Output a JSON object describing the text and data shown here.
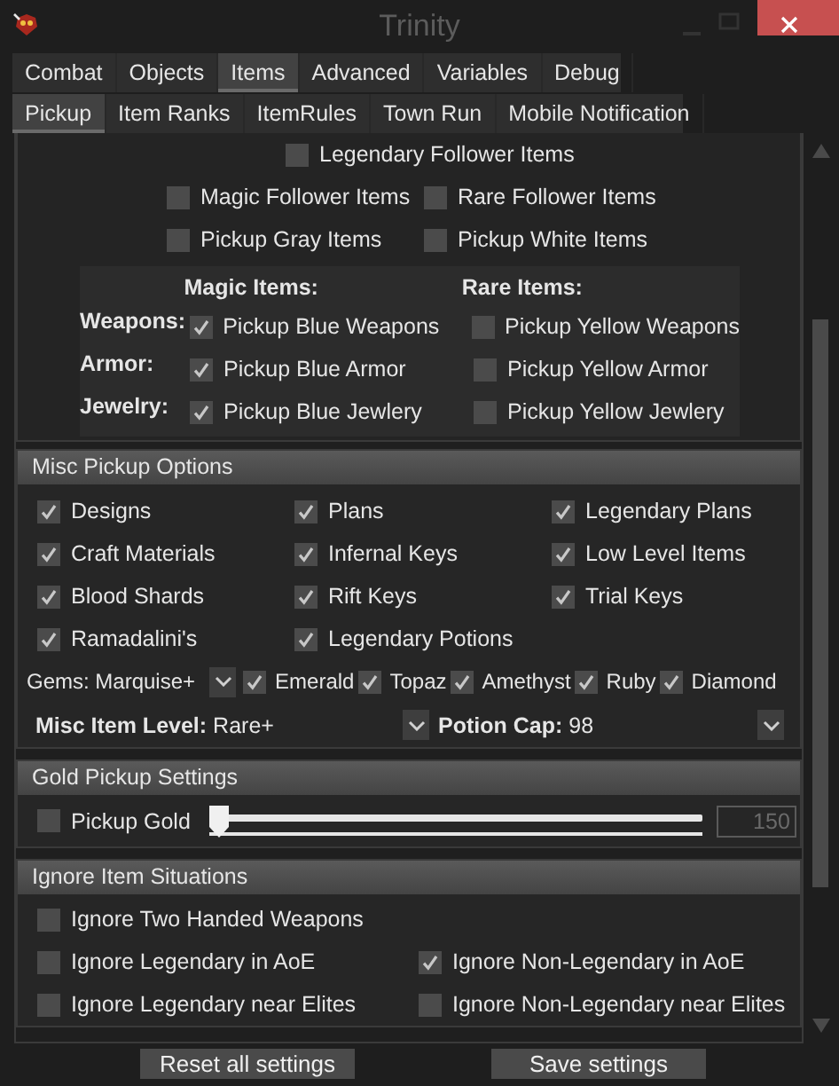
{
  "window": {
    "title": "Trinity"
  },
  "tabs": [
    {
      "label": "Combat",
      "selected": false
    },
    {
      "label": "Objects",
      "selected": false
    },
    {
      "label": "Items",
      "selected": true
    },
    {
      "label": "Advanced",
      "selected": false
    },
    {
      "label": "Variables",
      "selected": false
    },
    {
      "label": "Debug",
      "selected": false
    }
  ],
  "subtabs": [
    {
      "label": "Pickup",
      "selected": true
    },
    {
      "label": "Item Ranks",
      "selected": false
    },
    {
      "label": "ItemRules",
      "selected": false
    },
    {
      "label": "Town Run",
      "selected": false
    },
    {
      "label": "Mobile Notification",
      "selected": false
    }
  ],
  "follower": {
    "top_item": {
      "label": "Legendary Follower Items",
      "checked": false
    },
    "rows": [
      [
        {
          "label": "Magic Follower Items",
          "checked": false
        },
        {
          "label": "Rare Follower Items",
          "checked": false
        }
      ],
      [
        {
          "label": "Pickup Gray Items",
          "checked": false
        },
        {
          "label": "Pickup White Items",
          "checked": false
        }
      ]
    ]
  },
  "quality": {
    "columns": [
      "Magic Items:",
      "Rare Items:"
    ],
    "rows": [
      {
        "label": "Weapons:",
        "magic": {
          "label": "Pickup Blue Weapons",
          "checked": true
        },
        "rare": {
          "label": "Pickup Yellow Weapons",
          "checked": false
        }
      },
      {
        "label": "Armor:",
        "magic": {
          "label": "Pickup Blue Armor",
          "checked": true
        },
        "rare": {
          "label": "Pickup Yellow Armor",
          "checked": false
        }
      },
      {
        "label": "Jewelry:",
        "magic": {
          "label": "Pickup Blue Jewlery",
          "checked": true
        },
        "rare": {
          "label": "Pickup Yellow Jewlery",
          "checked": false
        }
      }
    ]
  },
  "misc": {
    "title": "Misc Pickup Options",
    "options": [
      {
        "label": "Designs",
        "checked": true
      },
      {
        "label": "Plans",
        "checked": true
      },
      {
        "label": "Legendary Plans",
        "checked": true
      },
      {
        "label": "Craft Materials",
        "checked": true
      },
      {
        "label": "Infernal Keys",
        "checked": true
      },
      {
        "label": "Low Level Items",
        "checked": true
      },
      {
        "label": "Blood Shards",
        "checked": true
      },
      {
        "label": "Rift Keys",
        "checked": true
      },
      {
        "label": "Trial Keys",
        "checked": true
      },
      {
        "label": "Ramadalini's",
        "checked": true
      },
      {
        "label": "Legendary Potions",
        "checked": true
      }
    ],
    "gems": {
      "label": "Gems:",
      "value": "Marquise+",
      "items": [
        {
          "label": "Emerald",
          "checked": true
        },
        {
          "label": "Topaz",
          "checked": true
        },
        {
          "label": "Amethyst",
          "checked": true
        },
        {
          "label": "Ruby",
          "checked": true
        },
        {
          "label": "Diamond",
          "checked": true
        }
      ]
    },
    "misc_item_level": {
      "label": "Misc Item Level:",
      "value": "Rare+"
    },
    "potion_cap": {
      "label": "Potion Cap:",
      "value": "98"
    }
  },
  "gold": {
    "title": "Gold Pickup Settings",
    "pickup": {
      "label": "Pickup Gold",
      "checked": false
    },
    "slider": {
      "level": 0
    },
    "amount": "150"
  },
  "ignore": {
    "title": "Ignore Item Situations",
    "rows": [
      [
        {
          "label": "Ignore Two Handed Weapons",
          "checked": false
        }
      ],
      [
        {
          "label": "Ignore Legendary in AoE",
          "checked": false
        },
        {
          "label": "Ignore Non-Legendary in AoE",
          "checked": true
        }
      ],
      [
        {
          "label": "Ignore Legendary near Elites",
          "checked": false
        },
        {
          "label": "Ignore Non-Legendary near Elites",
          "checked": false
        }
      ]
    ]
  },
  "buttons": [
    "Reset all settings",
    "Save settings"
  ]
}
